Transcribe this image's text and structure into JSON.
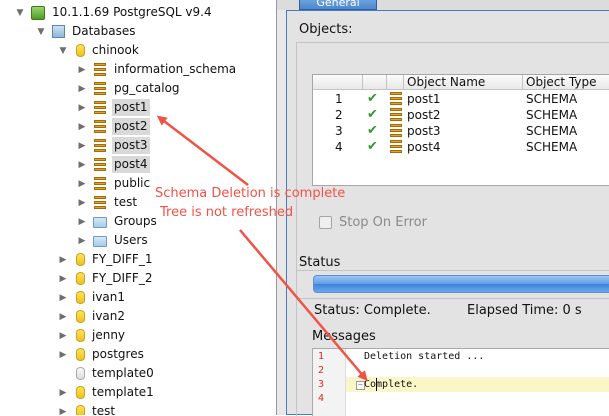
{
  "tree": {
    "server": "10.1.1.69 PostgreSQL  v9.4",
    "databases_label": "Databases",
    "chinook": "chinook",
    "schemas": [
      "information_schema",
      "pg_catalog",
      "post1",
      "post2",
      "post3",
      "post4",
      "public",
      "test"
    ],
    "groups": "Groups",
    "users": "Users",
    "dbs": [
      "FY_DIFF_1",
      "FY_DIFF_2",
      "ivan1",
      "ivan2",
      "jenny",
      "postgres",
      "template0",
      "template1",
      "test"
    ]
  },
  "panel": {
    "tab": "General",
    "objects_label": "Objects:",
    "columns": [
      "Object Name",
      "Object Type"
    ],
    "rows": [
      {
        "num": "1",
        "name": "post1",
        "type": "SCHEMA"
      },
      {
        "num": "2",
        "name": "post2",
        "type": "SCHEMA"
      },
      {
        "num": "3",
        "name": "post3",
        "type": "SCHEMA"
      },
      {
        "num": "4",
        "name": "post4",
        "type": "SCHEMA"
      }
    ],
    "stop_on_error": "Stop On Error",
    "status_label": "Status",
    "progress_fraction": 1.0,
    "status_text": "Status: Complete.",
    "elapsed_text": "Elapsed Time: 0 s",
    "messages_label": "Messages",
    "message_lines": [
      {
        "n": "1",
        "text": "Deletion started ..."
      },
      {
        "n": "2",
        "text": ""
      },
      {
        "n": "3",
        "text": "Complete."
      },
      {
        "n": "4",
        "text": ""
      }
    ]
  },
  "annotation": {
    "line1": "Schema Deletion is complete",
    "line2": "Tree is not refreshed",
    "color": "#f05346"
  }
}
